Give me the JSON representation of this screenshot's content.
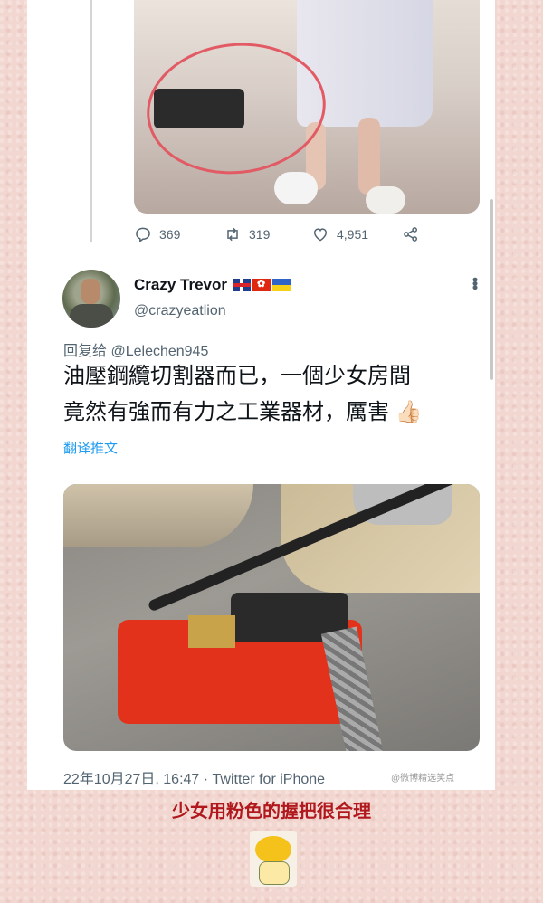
{
  "stats": {
    "replies": "369",
    "retweets": "319",
    "likes": "4,951"
  },
  "tweet": {
    "author_name": "Crazy Trevor",
    "flags": [
      "uk-flag",
      "hk-flag",
      "ukraine-flag"
    ],
    "handle": "@crazyeatlion",
    "reply_prefix": "回复给",
    "reply_to": "@Lelechen945",
    "text_line1": "油壓鋼纜切割器而已，一個少女房間",
    "text_line2": "竟然有強而有力之工業器材，厲害",
    "emoji": "👍🏻",
    "translate": "翻译推文",
    "timestamp": "22年10月27日, 16:47 · Twitter for iPhone"
  },
  "watermark": "@微博精选笑点",
  "caption": "少女用粉色的握把很合理",
  "colors": {
    "caption": "#b1181d",
    "link": "#1d9bf0",
    "muted": "#536471",
    "circle": "#e25a64"
  }
}
